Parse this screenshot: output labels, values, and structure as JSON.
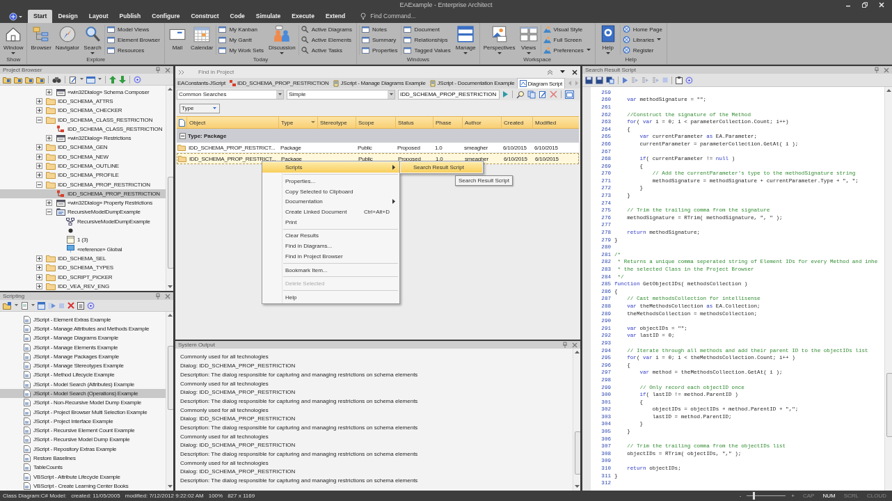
{
  "window": {
    "title": "EAExample - Enterprise Architect"
  },
  "ribbon_tabs": [
    {
      "label": "Start",
      "selected": true
    },
    {
      "label": "Design",
      "selected": false
    },
    {
      "label": "Layout",
      "selected": false
    },
    {
      "label": "Publish",
      "selected": false
    },
    {
      "label": "Configure",
      "selected": false
    },
    {
      "label": "Construct",
      "selected": false
    },
    {
      "label": "Code",
      "selected": false
    },
    {
      "label": "Simulate",
      "selected": false
    },
    {
      "label": "Execute",
      "selected": false
    },
    {
      "label": "Extend",
      "selected": false
    }
  ],
  "find_command": {
    "placeholder": "Find Command..."
  },
  "ribbon_groups": [
    {
      "label": "Show",
      "items": [
        {
          "kind": "large",
          "label": "Window",
          "dropdown": true
        }
      ]
    },
    {
      "label": "Explore",
      "items": [
        {
          "kind": "large",
          "label": "Browser",
          "dropdown": false
        },
        {
          "kind": "large",
          "label": "Navigator",
          "dropdown": false
        },
        {
          "kind": "large",
          "label": "Search",
          "dropdown": true
        },
        {
          "kind": "column",
          "entries": [
            {
              "label": "Model Views",
              "dropdown": false
            },
            {
              "label": "Element Browser",
              "dropdown": false
            },
            {
              "label": "Resources",
              "dropdown": false
            }
          ]
        }
      ]
    },
    {
      "label": "Today",
      "items": [
        {
          "kind": "large",
          "label": "Mail",
          "dropdown": false
        },
        {
          "kind": "large",
          "label": "Calendar",
          "dropdown": false
        },
        {
          "kind": "column",
          "entries": [
            {
              "label": "My Kanban",
              "dropdown": false
            },
            {
              "label": "My Gantt",
              "dropdown": false
            },
            {
              "label": "My Work Sets",
              "dropdown": false
            }
          ]
        },
        {
          "kind": "large",
          "label": "Discussion",
          "dropdown": true
        },
        {
          "kind": "column",
          "entries": [
            {
              "label": "Active Diagrams",
              "dropdown": false
            },
            {
              "label": "Active Elements",
              "dropdown": false
            },
            {
              "label": "Active Tasks",
              "dropdown": false
            }
          ]
        }
      ]
    },
    {
      "label": "Windows",
      "items": [
        {
          "kind": "column",
          "entries": [
            {
              "label": "Notes",
              "dropdown": false
            },
            {
              "label": "Summary",
              "dropdown": false
            },
            {
              "label": "Properties",
              "dropdown": false
            }
          ]
        },
        {
          "kind": "column",
          "entries": [
            {
              "label": "Document",
              "dropdown": false
            },
            {
              "label": "Relationships",
              "dropdown": false
            },
            {
              "label": "Tagged Values",
              "dropdown": false
            }
          ]
        },
        {
          "kind": "large",
          "label": "Manage",
          "dropdown": true
        }
      ]
    },
    {
      "label": "Workspace",
      "items": [
        {
          "kind": "large",
          "label": "Perspectives",
          "dropdown": true
        },
        {
          "kind": "large",
          "label": "Views",
          "dropdown": true
        },
        {
          "kind": "column",
          "entries": [
            {
              "label": "Visual Style",
              "dropdown": false
            },
            {
              "label": "Full Screen",
              "dropdown": false
            },
            {
              "label": "Preferences",
              "dropdown": true
            }
          ]
        }
      ]
    },
    {
      "label": "Help",
      "items": [
        {
          "kind": "large",
          "label": "Help",
          "dropdown": true
        },
        {
          "kind": "column",
          "entries": [
            {
              "label": "Home Page",
              "dropdown": false
            },
            {
              "label": "Libraries",
              "dropdown": true
            },
            {
              "label": "Register",
              "dropdown": false
            }
          ]
        }
      ]
    }
  ],
  "project_browser": {
    "title": "Project Browser",
    "tree_continued": [
      {
        "label": "«win32Dialog» Schema Composer",
        "kind": "dialog",
        "expanded": false,
        "selected": false
      }
    ],
    "tree": [
      {
        "label": "IDD_SCHEMA_ATTRS",
        "kind": "folder",
        "expanded": false,
        "selected": false
      },
      {
        "label": "IDD_SCHEMA_CHECKER",
        "kind": "folder",
        "expanded": false,
        "selected": false
      },
      {
        "label": "IDD_SCHEMA_CLASS_RESTRICTION",
        "kind": "folder",
        "expanded": true,
        "selected": false,
        "children": [
          {
            "label": "IDD_SCHEMA_CLASS_RESTRICTION",
            "kind": "class",
            "selected": false
          },
          {
            "label": "«win32Dialog» Restrictions",
            "kind": "dialog",
            "expanded": false,
            "selected": false
          }
        ]
      },
      {
        "label": "IDD_SCHEMA_GEN",
        "kind": "folder",
        "expanded": false,
        "selected": false
      },
      {
        "label": "IDD_SCHEMA_NEW",
        "kind": "folder",
        "expanded": false,
        "selected": false
      },
      {
        "label": "IDD_SCHEMA_OUTLINE",
        "kind": "folder",
        "expanded": false,
        "selected": false
      },
      {
        "label": "IDD_SCHEMA_PROFILE",
        "kind": "folder",
        "expanded": false,
        "selected": false
      },
      {
        "label": "IDD_SCHEMA_PROP_RESTRICTION",
        "kind": "folder",
        "expanded": true,
        "selected": false,
        "children": [
          {
            "label": "IDD_SCHEMA_PROP_RESTRICTION",
            "kind": "class",
            "selected": true
          },
          {
            "label": "«win32Dialog» Property Restrictions",
            "kind": "dialog",
            "expanded": false,
            "selected": false
          },
          {
            "label": "RecursiveModelDumpExample",
            "kind": "package",
            "expanded": true,
            "selected": false,
            "children": [
              {
                "label": "RecursiveModelDumpExample",
                "kind": "diagram",
                "selected": false
              },
              {
                "kind": "point",
                "selected": false
              },
              {
                "label": "1 (3)",
                "kind": "note",
                "selected": false
              },
              {
                "label": "«reference» Global",
                "kind": "reference",
                "selected": false
              }
            ]
          }
        ]
      },
      {
        "label": "IDD_SCHEMA_SEL",
        "kind": "folder",
        "expanded": false,
        "selected": false
      },
      {
        "label": "IDD_SCHEMA_TYPES",
        "kind": "folder",
        "expanded": false,
        "selected": false
      },
      {
        "label": "IDD_SCRIPT_PICKER",
        "kind": "folder",
        "expanded": false,
        "selected": false
      },
      {
        "label": "IDD_VEA_REV_ENG",
        "kind": "folder",
        "expanded": false,
        "selected": false
      }
    ]
  },
  "scripting": {
    "title": "Scripting",
    "items": [
      {
        "label": "JScript - Element Extras Example",
        "selected": false
      },
      {
        "label": "JScript - Manage Attributes and Methods Example",
        "selected": false
      },
      {
        "label": "JScript - Manage Diagrams Example",
        "selected": false
      },
      {
        "label": "JScript - Manage Elements Example",
        "selected": false
      },
      {
        "label": "JScript - Manage Packages Example",
        "selected": false
      },
      {
        "label": "JScript - Manage Stereotypes Example",
        "selected": false
      },
      {
        "label": "JScript - Method Lifecycle Example",
        "selected": false
      },
      {
        "label": "JScript - Model Search (Attributes) Example",
        "selected": false
      },
      {
        "label": "JScript - Model Search (Operations) Example",
        "selected": true
      },
      {
        "label": "JScript - Non-Recursive Model Dump Example",
        "selected": false
      },
      {
        "label": "JScript - Project Browser Multi Selection Example",
        "selected": false
      },
      {
        "label": "JScript - Project Interface Example",
        "selected": false
      },
      {
        "label": "JScript - Recursive Element Count Example",
        "selected": false
      },
      {
        "label": "JScript - Recursive Model Dump Example",
        "selected": false
      },
      {
        "label": "JScript - Repository Extras Example",
        "selected": false
      },
      {
        "label": "Restore Baselines",
        "selected": false
      },
      {
        "label": "TableCounts",
        "selected": false
      },
      {
        "label": "VBScript - Attribute Lifecycle Example",
        "selected": false
      },
      {
        "label": "VBScript - Create Learning Center Books",
        "selected": false
      }
    ]
  },
  "find_in_project": {
    "title": "Find in Project",
    "doc_tabs": [
      {
        "label": "EAConstants-JScript",
        "kind": "plain",
        "selected": false
      },
      {
        "label": "IDD_SCHEMA_PROP_RESTRICTION",
        "kind": "class",
        "selected": false
      },
      {
        "label": "JScript - Manage Diagrams Example",
        "kind": "script",
        "selected": false
      },
      {
        "label": "JScript - Documentation Example",
        "kind": "script",
        "selected": false
      },
      {
        "label": "Diagram Script",
        "kind": "diagram",
        "selected": true
      }
    ],
    "search_category": "Common Searches",
    "search_mode": "Simple",
    "search_term": "IDD_SCHEMA_PROP_RESTRICTION",
    "group_by": "Type",
    "columns": [
      "Object",
      "Type",
      "Stereotype",
      "Scope",
      "Status",
      "Phase",
      "Author",
      "Created",
      "Modified"
    ],
    "group": {
      "label": "Type: Package",
      "expanded": true
    },
    "rows": [
      {
        "selected": false,
        "cells": [
          "IDD_SCHEMA_PROP_RESTRICT...",
          "Package",
          null,
          "Public",
          "Proposed",
          "1.0",
          "smeagher",
          "6/10/2015",
          "6/10/2015"
        ]
      },
      {
        "selected": true,
        "cells": [
          "IDD_SCHEMA_PROP_RESTRICT...",
          "Package",
          null,
          "Public",
          "Proposed",
          "1.0",
          "smeagher",
          "6/10/2015",
          "6/10/2015"
        ]
      }
    ]
  },
  "context_menu": {
    "items": [
      {
        "kind": "item",
        "label": "Scripts",
        "submenu": true,
        "highlighted": true,
        "disabled": false
      },
      {
        "kind": "separator"
      },
      {
        "kind": "item",
        "label": "Properties...",
        "submenu": false,
        "highlighted": false,
        "disabled": false
      },
      {
        "kind": "item",
        "label": "Copy Selected to Clipboard",
        "submenu": false,
        "highlighted": false,
        "disabled": false
      },
      {
        "kind": "item",
        "label": "Documentation",
        "submenu": true,
        "highlighted": false,
        "disabled": false
      },
      {
        "kind": "item",
        "label": "Create Linked Document",
        "shortcut": "Ctrl+Alt+D",
        "submenu": false,
        "highlighted": false,
        "disabled": false
      },
      {
        "kind": "item",
        "label": "Print",
        "submenu": false,
        "highlighted": false,
        "disabled": false
      },
      {
        "kind": "separator"
      },
      {
        "kind": "item",
        "label": "Clear Results",
        "submenu": false,
        "highlighted": false,
        "disabled": false
      },
      {
        "kind": "item",
        "label": "Find in Diagrams...",
        "submenu": false,
        "highlighted": false,
        "disabled": false
      },
      {
        "kind": "item",
        "label": "Find in Project Browser",
        "submenu": false,
        "highlighted": false,
        "disabled": false
      },
      {
        "kind": "separator"
      },
      {
        "kind": "item",
        "label": "Bookmark Item...",
        "submenu": false,
        "highlighted": false,
        "disabled": false
      },
      {
        "kind": "separator"
      },
      {
        "kind": "item",
        "label": "Delete Selected",
        "submenu": false,
        "highlighted": false,
        "disabled": true
      },
      {
        "kind": "separator"
      },
      {
        "kind": "item",
        "label": "Help",
        "submenu": false,
        "highlighted": false,
        "disabled": false
      }
    ],
    "submenu": [
      {
        "label": "Search Result Script",
        "highlighted": true
      }
    ],
    "tooltip": "Search Result Script"
  },
  "system_output": {
    "title": "System Output",
    "lines": [
      "Commonly used for all technologies",
      "Dialog: IDD_SCHEMA_PROP_RESTRICTION",
      "Description: The dialog responsible for capturing and managing restrictions on schema elements",
      "Commonly used for all technologies",
      "Dialog: IDD_SCHEMA_PROP_RESTRICTION",
      "Description: The dialog responsible for capturing and managing restrictions on schema elements",
      "Commonly used for all technologies",
      "Dialog: IDD_SCHEMA_PROP_RESTRICTION",
      "Description: The dialog responsible for capturing and managing restrictions on schema elements",
      "Commonly used for all technologies",
      "Dialog: IDD_SCHEMA_PROP_RESTRICTION",
      "Description: The dialog responsible for capturing and managing restrictions on schema elements",
      "Commonly used for all technologies",
      "Dialog: IDD_SCHEMA_PROP_RESTRICTION",
      "Description: The dialog responsible for capturing and managing restrictions on schema elements"
    ]
  },
  "script_editor": {
    "title": "Search Result Script",
    "lines": [
      {
        "number": "259"
      },
      {
        "number": "260",
        "parts": [
          {
            "kind": "keyword",
            "text": "    var"
          },
          {
            "kind": "plain",
            "text": " methodSignature = \"\";"
          }
        ]
      },
      {
        "number": "261"
      },
      {
        "number": "262",
        "parts": [
          {
            "kind": "comment",
            "text": "    //Construct the signature of the Method"
          }
        ]
      },
      {
        "number": "263",
        "parts": [
          {
            "kind": "keyword",
            "text": "    for"
          },
          {
            "kind": "plain",
            "text": "( "
          },
          {
            "kind": "keyword",
            "text": "var"
          },
          {
            "kind": "plain",
            "text": " i = 0; i < parameterCollection.Count; i++)"
          }
        ]
      },
      {
        "number": "264",
        "parts": [
          {
            "kind": "plain",
            "text": "    {"
          }
        ]
      },
      {
        "number": "265",
        "parts": [
          {
            "kind": "keyword",
            "text": "        var"
          },
          {
            "kind": "plain",
            "text": " currentParameter "
          },
          {
            "kind": "keyword",
            "text": "as"
          },
          {
            "kind": "plain",
            "text": " EA.Parameter;"
          }
        ]
      },
      {
        "number": "266",
        "parts": [
          {
            "kind": "plain",
            "text": "        currentParameter = parameterCollection.GetAt( i );"
          }
        ]
      },
      {
        "number": "267"
      },
      {
        "number": "268",
        "parts": [
          {
            "kind": "keyword",
            "text": "        if"
          },
          {
            "kind": "plain",
            "text": "( currentParameter != "
          },
          {
            "kind": "keyword",
            "text": "null"
          },
          {
            "kind": "plain",
            "text": " )"
          }
        ]
      },
      {
        "number": "269",
        "parts": [
          {
            "kind": "plain",
            "text": "        {"
          }
        ]
      },
      {
        "number": "270",
        "parts": [
          {
            "kind": "comment",
            "text": "            // Add the currentParameter's type to the methodSignature string"
          }
        ]
      },
      {
        "number": "271",
        "parts": [
          {
            "kind": "plain",
            "text": "            methodSignature = methodSignature + currentParameter.Type + \", \";"
          }
        ]
      },
      {
        "number": "272",
        "parts": [
          {
            "kind": "plain",
            "text": "        }"
          }
        ]
      },
      {
        "number": "273",
        "parts": [
          {
            "kind": "plain",
            "text": "    }"
          }
        ]
      },
      {
        "number": "274"
      },
      {
        "number": "275",
        "parts": [
          {
            "kind": "comment",
            "text": "    // Trim the trailing comma from the signature"
          }
        ]
      },
      {
        "number": "276",
        "parts": [
          {
            "kind": "plain",
            "text": "    methodSignature = RTrim( methodSignature, \", \" );"
          }
        ]
      },
      {
        "number": "277"
      },
      {
        "number": "278",
        "parts": [
          {
            "kind": "keyword",
            "text": "    return"
          },
          {
            "kind": "plain",
            "text": " methodSignature;"
          }
        ]
      },
      {
        "number": "279",
        "parts": [
          {
            "kind": "plain",
            "text": "}"
          }
        ]
      },
      {
        "number": "280"
      },
      {
        "number": "281",
        "parts": [
          {
            "kind": "comment",
            "text": "/*"
          }
        ]
      },
      {
        "number": "282",
        "parts": [
          {
            "kind": "comment",
            "text": " * Returns a unique comma seperated string of Element IDs for every Method and inhe"
          }
        ]
      },
      {
        "number": "283",
        "parts": [
          {
            "kind": "comment",
            "text": " * the selected Class in the Project Browser"
          }
        ]
      },
      {
        "number": "284",
        "parts": [
          {
            "kind": "comment",
            "text": " */"
          }
        ]
      },
      {
        "number": "285",
        "parts": [
          {
            "kind": "keyword",
            "text": "function"
          },
          {
            "kind": "plain",
            "text": " GetObjectIDs( methodsCollection )"
          }
        ]
      },
      {
        "number": "286",
        "parts": [
          {
            "kind": "plain",
            "text": "{"
          }
        ]
      },
      {
        "number": "287",
        "parts": [
          {
            "kind": "comment",
            "text": "    // Cast methodsCollection for intellisense"
          }
        ]
      },
      {
        "number": "288",
        "parts": [
          {
            "kind": "keyword",
            "text": "    var"
          },
          {
            "kind": "plain",
            "text": " theMethodsCollection "
          },
          {
            "kind": "keyword",
            "text": "as"
          },
          {
            "kind": "plain",
            "text": " EA.Collection;"
          }
        ]
      },
      {
        "number": "289",
        "parts": [
          {
            "kind": "plain",
            "text": "    theMethodsCollection = methodsCollection;"
          }
        ]
      },
      {
        "number": "290"
      },
      {
        "number": "291",
        "parts": [
          {
            "kind": "keyword",
            "text": "    var"
          },
          {
            "kind": "plain",
            "text": " objectIDs = \"\";"
          }
        ]
      },
      {
        "number": "292",
        "parts": [
          {
            "kind": "keyword",
            "text": "    var"
          },
          {
            "kind": "plain",
            "text": " lastID = 0;"
          }
        ]
      },
      {
        "number": "293"
      },
      {
        "number": "294",
        "parts": [
          {
            "kind": "comment",
            "text": "    // Iterate through all methods and add their parent ID to the objectIDs list"
          }
        ]
      },
      {
        "number": "295",
        "parts": [
          {
            "kind": "keyword",
            "text": "    for"
          },
          {
            "kind": "plain",
            "text": "( "
          },
          {
            "kind": "keyword",
            "text": "var"
          },
          {
            "kind": "plain",
            "text": " i = 0; i < theMethodsCollection.Count; i++ )"
          }
        ]
      },
      {
        "number": "296",
        "parts": [
          {
            "kind": "plain",
            "text": "    {"
          }
        ]
      },
      {
        "number": "297",
        "parts": [
          {
            "kind": "keyword",
            "text": "        var"
          },
          {
            "kind": "plain",
            "text": " method = theMethodsCollection.GetAt( i );"
          }
        ]
      },
      {
        "number": "298"
      },
      {
        "number": "299",
        "parts": [
          {
            "kind": "comment",
            "text": "        // Only record each objectID once"
          }
        ]
      },
      {
        "number": "300",
        "parts": [
          {
            "kind": "keyword",
            "text": "        if"
          },
          {
            "kind": "plain",
            "text": "( lastID != method.ParentID )"
          }
        ]
      },
      {
        "number": "301",
        "parts": [
          {
            "kind": "plain",
            "text": "        {"
          }
        ]
      },
      {
        "number": "302",
        "parts": [
          {
            "kind": "plain",
            "text": "            objectIDs = objectIDs + method.ParentID + \",\";"
          }
        ]
      },
      {
        "number": "303",
        "parts": [
          {
            "kind": "plain",
            "text": "            lastID = method.ParentID;"
          }
        ]
      },
      {
        "number": "304",
        "parts": [
          {
            "kind": "plain",
            "text": "        }"
          }
        ]
      },
      {
        "number": "305",
        "parts": [
          {
            "kind": "plain",
            "text": "    }"
          }
        ]
      },
      {
        "number": "306"
      },
      {
        "number": "307",
        "parts": [
          {
            "kind": "comment",
            "text": "    // Trim the trailing comma from the objectIDs list"
          }
        ]
      },
      {
        "number": "308",
        "parts": [
          {
            "kind": "plain",
            "text": "    objectIDs = RTrim( objectIDs, \",\" );"
          }
        ]
      },
      {
        "number": "309"
      },
      {
        "number": "310",
        "parts": [
          {
            "kind": "keyword",
            "text": "    return"
          },
          {
            "kind": "plain",
            "text": " objectIDs;"
          }
        ]
      },
      {
        "number": "311",
        "parts": [
          {
            "kind": "plain",
            "text": "}"
          }
        ]
      },
      {
        "number": "312"
      }
    ]
  },
  "status_bar": {
    "segments": [
      "Class Diagram:C# Model:",
      "created: 11/05/2005",
      "modified: 7/12/2012 9:22:02 AM",
      "100%",
      "827 x 1169"
    ],
    "zoom_out": "-",
    "zoom_in": "+",
    "zoom": {
      "level": 0.18
    },
    "indicators": [
      {
        "label": "CAP",
        "on": false
      },
      {
        "label": "NUM",
        "on": true
      },
      {
        "label": "SCRL",
        "on": false
      },
      {
        "label": "CLOUD",
        "on": false
      }
    ]
  }
}
